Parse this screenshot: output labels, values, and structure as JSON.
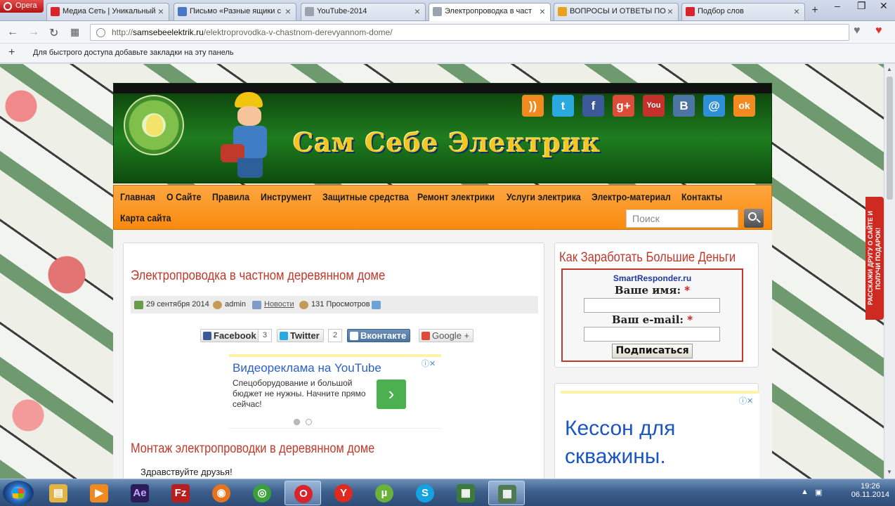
{
  "browser": {
    "app_name": "Opera",
    "tabs": [
      {
        "label": "Медиа Сеть | Уникальный",
        "icon": "mediaset-icon",
        "color": "#d9232d"
      },
      {
        "label": "Письмо «Разные ящики с",
        "icon": "mail-icon",
        "color": "#4a78c8"
      },
      {
        "label": "YouTube-2014",
        "icon": "page-icon",
        "color": "#9aa4b0"
      },
      {
        "label": "Электропроводка в част",
        "icon": "page-icon",
        "color": "#9aa4b0",
        "active": true
      },
      {
        "label": "ВОПРОСЫ И ОТВЕТЫ ПО",
        "icon": "home-icon",
        "color": "#e7a21b"
      },
      {
        "label": "Подбор слов",
        "icon": "chart-icon",
        "color": "#d9232d"
      }
    ],
    "url_host": "samsebeelektrik.ru",
    "url_rest": "/elektroprovodka-v-chastnom-derevyannom-dome/",
    "url_prefix": "http://",
    "bookmarks_hint": "Для быстрого доступа добавьте закладки на эту панель"
  },
  "site": {
    "title": "Сам Себе Электрик",
    "logo_text": "САМ СЕБЕ ЭЛЕКТРИК",
    "social": [
      {
        "name": "rss-icon",
        "glyph": "))",
        "color": "#f08a1e"
      },
      {
        "name": "twitter-icon",
        "glyph": "t",
        "color": "#2aa9e0"
      },
      {
        "name": "facebook-icon",
        "glyph": "f",
        "color": "#3b5998"
      },
      {
        "name": "google-plus-icon",
        "glyph": "g+",
        "color": "#dd4b39"
      },
      {
        "name": "youtube-icon",
        "glyph": "You",
        "color": "#c4302b"
      },
      {
        "name": "vkontakte-icon",
        "glyph": "B",
        "color": "#4c75a3"
      },
      {
        "name": "mail-at-icon",
        "glyph": "@",
        "color": "#2f8fd6"
      },
      {
        "name": "odnoklassniki-icon",
        "glyph": "ok",
        "color": "#f28a1f"
      }
    ],
    "menu": [
      "Главная",
      "О Сайте",
      "Правила",
      "Инструмент",
      "Защитные средства",
      "Ремонт электрики",
      "Услуги электрика",
      "Электро-материал",
      "Контакты",
      "Карта сайта"
    ],
    "search_placeholder": "Поиск",
    "side_banner": "РАССКАЖИ ДРУГУ О САЙТЕ И ПОЛУЧИ ПОДАРОК!"
  },
  "post": {
    "title": "Электропроводка в частном деревянном доме",
    "date": "29 сентября 2014",
    "author": "admin",
    "category": "Новости",
    "views": "131 Просмотров",
    "share": [
      {
        "label": "Facebook",
        "count": "3",
        "color": "#3b5998"
      },
      {
        "label": "Twitter",
        "count": "2",
        "color": "#2aa9e0"
      },
      {
        "label": "Вконтакте",
        "count": "",
        "color": "#4c75a3"
      },
      {
        "label": "Google +",
        "count": "",
        "color": "#dd4b39"
      }
    ],
    "ad": {
      "headline": "Видеореклама на YouTube",
      "body": "Спецоборудование и большой бюджет не нужны. Начните прямо сейчас!",
      "cta_glyph": "›"
    },
    "subtitle": "Монтаж электропроводки в деревянном доме",
    "greeting": "Здравствуйте друзья!"
  },
  "sidebar": {
    "widget_title": "Как Заработать Большие Деньги",
    "brand": "SmartResponder.ru",
    "name_label": "Ваше имя:",
    "email_label": "Ваш e-mail:",
    "required_mark": "*",
    "submit_label": "Подписаться",
    "ad2_text": "Кессон для скважины."
  },
  "taskbar": {
    "time": "19:26",
    "date": "06.11.2014",
    "apps": [
      {
        "name": "explorer-icon",
        "glyph": "▤",
        "color": "#e3b343"
      },
      {
        "name": "media-player-icon",
        "glyph": "▶",
        "color": "#f08a1e"
      },
      {
        "name": "after-effects-icon",
        "glyph": "Ae",
        "color": "#2b1d58"
      },
      {
        "name": "filezilla-icon",
        "glyph": "Fz",
        "color": "#b81e1e"
      },
      {
        "name": "firefox-icon",
        "glyph": "◉",
        "color": "#e8731c"
      },
      {
        "name": "chrome-icon",
        "glyph": "◎",
        "color": "#3b9f3b"
      },
      {
        "name": "opera-icon",
        "glyph": "O",
        "color": "#d9232d",
        "active": true
      },
      {
        "name": "yandex-icon",
        "glyph": "Y",
        "color": "#e02a20"
      },
      {
        "name": "utorrent-icon",
        "glyph": "µ",
        "color": "#6bb23a"
      },
      {
        "name": "skype-icon",
        "glyph": "S",
        "color": "#14a3e0"
      },
      {
        "name": "camtasia-icon",
        "glyph": "▦",
        "color": "#3c7a3c"
      },
      {
        "name": "recorder-icon",
        "glyph": "▦",
        "color": "#4f7a52",
        "active": true
      }
    ]
  }
}
